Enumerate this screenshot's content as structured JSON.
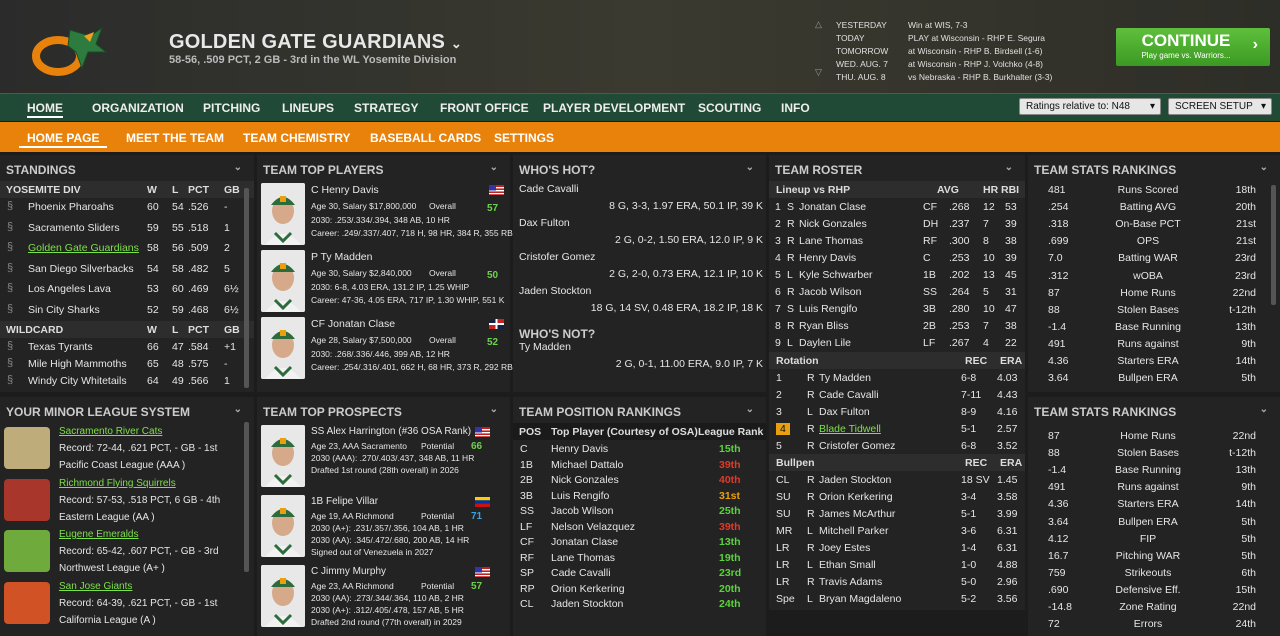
{
  "header": {
    "team_name": "GOLDEN GATE GUARDIANS",
    "record_line": "58-56, .509 PCT, 2 GB - 3rd in the WL Yosemite Division",
    "schedule": [
      {
        "day": "YESTERDAY",
        "text": "Win at WIS, 7-3"
      },
      {
        "day": "TODAY",
        "text": "PLAY at Wisconsin - RHP E. Segura"
      },
      {
        "day": "TOMORROW",
        "text": "at Wisconsin - RHP B. Birdsell (1-6)"
      },
      {
        "day": "WED. AUG. 7",
        "text": "at Wisconsin - RHP J. Volchko (4-8)"
      },
      {
        "day": "THU. AUG. 8",
        "text": "vs Nebraska - RHP B. Burkhalter (3-3)"
      }
    ],
    "continue_label": "CONTINUE",
    "continue_sub": "Play game vs. Warriors..."
  },
  "nav": {
    "main": [
      "HOME",
      "ORGANIZATION",
      "PITCHING",
      "LINEUPS",
      "STRATEGY",
      "FRONT OFFICE",
      "PLAYER DEVELOPMENT",
      "SCOUTING",
      "INFO"
    ],
    "ratings_select": "Ratings relative to: N48",
    "screen_setup": "SCREEN SETUP",
    "sub": [
      "HOME PAGE",
      "MEET THE TEAM",
      "TEAM CHEMISTRY",
      "BASEBALL CARDS",
      "SETTINGS"
    ]
  },
  "standings": {
    "title": "STANDINGS",
    "div_header": [
      "YOSEMITE DIV",
      "W",
      "L",
      "PCT",
      "GB"
    ],
    "div": [
      [
        "Phoenix Pharoahs",
        "60",
        "54",
        ".526",
        "-"
      ],
      [
        "Sacramento Sliders",
        "59",
        "55",
        ".518",
        "1"
      ],
      [
        "Golden Gate Guardians",
        "58",
        "56",
        ".509",
        "2"
      ],
      [
        "San Diego Silverbacks",
        "54",
        "58",
        ".482",
        "5"
      ],
      [
        "Los Angeles Lava",
        "53",
        "60",
        ".469",
        "6½"
      ],
      [
        "Sin City Sharks",
        "52",
        "59",
        ".468",
        "6½"
      ]
    ],
    "wc_header": [
      "WILDCARD",
      "W",
      "L",
      "PCT",
      "GB"
    ],
    "wc": [
      [
        "Texas Tyrants",
        "66",
        "47",
        ".584",
        "+1"
      ],
      [
        "Mile High Mammoths",
        "65",
        "48",
        ".575",
        "-"
      ],
      [
        "Windy City Whitetails",
        "64",
        "49",
        ".566",
        "1"
      ]
    ]
  },
  "top_players": {
    "title": "TEAM TOP PLAYERS",
    "players": [
      {
        "name": "C Henry Davis",
        "l1": "Age 30, Salary $17,800,000",
        "ovr_label": "Overall",
        "ovr": "57",
        "l2": "2030: .253/.334/.394, 348 AB, 10 HR",
        "l3": "Career: .249/.337/.407, 718 H, 98 HR, 384 R, 355 RBI"
      },
      {
        "name": "P Ty Madden",
        "l1": "Age 30, Salary $2,840,000",
        "ovr_label": "Overall",
        "ovr": "50",
        "l2": "2030: 6-8, 4.03 ERA, 131.2 IP, 1.25 WHIP",
        "l3": "Career: 47-36, 4.05 ERA, 717 IP, 1.30 WHIP, 551 K"
      },
      {
        "name": "CF Jonatan Clase",
        "l1": "Age 28, Salary $7,500,000",
        "ovr_label": "Overall",
        "ovr": "52",
        "l2": "2030: .268/.336/.446, 399 AB, 12 HR",
        "l3": "Career: .254/.316/.401, 662 H, 68 HR, 373 R, 292 RBI"
      }
    ]
  },
  "hot": {
    "title": "WHO'S HOT?",
    "items": [
      [
        "Cade Cavalli",
        "8 G, 3-3, 1.97 ERA, 50.1 IP, 39 K"
      ],
      [
        "Dax Fulton",
        "2 G, 0-2, 1.50 ERA, 12.0 IP, 9 K"
      ],
      [
        "Cristofer Gomez",
        "2 G, 2-0, 0.73 ERA, 12.1 IP, 10 K"
      ],
      [
        "Jaden Stockton",
        "18 G, 14 SV, 0.48 ERA, 18.2 IP, 18 K"
      ]
    ],
    "not_title": "WHO'S NOT?",
    "not_items": [
      [
        "Ty Madden",
        "2 G, 0-1, 11.00 ERA, 9.0 IP, 7 K"
      ]
    ]
  },
  "roster": {
    "title": "TEAM ROSTER",
    "lineup_header": [
      "Lineup vs RHP",
      "AVG",
      "HR",
      "RBI"
    ],
    "lineup": [
      [
        "1",
        "S",
        "Jonatan Clase",
        "CF",
        ".268",
        "12",
        "53"
      ],
      [
        "2",
        "R",
        "Nick Gonzales",
        "DH",
        ".237",
        "7",
        "39"
      ],
      [
        "3",
        "R",
        "Lane Thomas",
        "RF",
        ".300",
        "8",
        "38"
      ],
      [
        "4",
        "R",
        "Henry Davis",
        "C",
        ".253",
        "10",
        "39"
      ],
      [
        "5",
        "L",
        "Kyle Schwarber",
        "1B",
        ".202",
        "13",
        "45"
      ],
      [
        "6",
        "R",
        "Jacob Wilson",
        "SS",
        ".264",
        "5",
        "31"
      ],
      [
        "7",
        "S",
        "Luis Rengifo",
        "3B",
        ".280",
        "10",
        "47"
      ],
      [
        "8",
        "R",
        "Ryan Bliss",
        "2B",
        ".253",
        "7",
        "38"
      ],
      [
        "9",
        "L",
        "Daylen Lile",
        "LF",
        ".267",
        "4",
        "22"
      ]
    ],
    "rot_header": [
      "Rotation",
      "REC",
      "ERA"
    ],
    "rotation": [
      [
        "1",
        "R",
        "Ty Madden",
        "6-8",
        "4.03"
      ],
      [
        "2",
        "R",
        "Cade Cavalli",
        "7-11",
        "4.43"
      ],
      [
        "3",
        "L",
        "Dax Fulton",
        "8-9",
        "4.16"
      ],
      [
        "4",
        "R",
        "Blade Tidwell",
        "5-1",
        "2.57"
      ],
      [
        "5",
        "R",
        "Cristofer Gomez",
        "6-8",
        "3.52"
      ]
    ],
    "bp_header": [
      "Bullpen",
      "REC",
      "ERA"
    ],
    "bullpen": [
      [
        "CL",
        "R",
        "Jaden Stockton",
        "18 SV",
        "1.45"
      ],
      [
        "SU",
        "R",
        "Orion Kerkering",
        "3-4",
        "3.58"
      ],
      [
        "SU",
        "R",
        "James McArthur",
        "5-1",
        "3.99"
      ],
      [
        "MR",
        "L",
        "Mitchell Parker",
        "3-6",
        "6.31"
      ],
      [
        "LR",
        "R",
        "Joey Estes",
        "1-4",
        "6.31"
      ],
      [
        "LR",
        "L",
        "Ethan Small",
        "1-0",
        "4.88"
      ],
      [
        "LR",
        "R",
        "Travis Adams",
        "5-0",
        "2.96"
      ],
      [
        "Spe",
        "L",
        "Bryan Magdaleno",
        "5-2",
        "3.56"
      ]
    ]
  },
  "stats1": {
    "title": "TEAM STATS RANKINGS",
    "rows": [
      [
        "481",
        "Runs Scored",
        "18th"
      ],
      [
        ".254",
        "Batting AVG",
        "20th"
      ],
      [
        ".318",
        "On-Base PCT",
        "21st"
      ],
      [
        ".699",
        "OPS",
        "21st"
      ],
      [
        "7.0",
        "Batting WAR",
        "23rd"
      ],
      [
        ".312",
        "wOBA",
        "23rd"
      ],
      [
        "87",
        "Home Runs",
        "22nd"
      ],
      [
        "88",
        "Stolen Bases",
        "t-12th"
      ],
      [
        "-1.4",
        "Base Running",
        "13th"
      ],
      [
        "491",
        "Runs against",
        "9th"
      ],
      [
        "4.36",
        "Starters ERA",
        "14th"
      ],
      [
        "3.64",
        "Bullpen ERA",
        "5th"
      ]
    ]
  },
  "minors": {
    "title": "YOUR MINOR LEAGUE SYSTEM",
    "teams": [
      {
        "name": "Sacramento River Cats",
        "l1": "Record: 72-44, .621 PCT, - GB - 1st",
        "l2": "Pacific Coast League (AAA )"
      },
      {
        "name": "Richmond Flying Squirrels",
        "l1": "Record: 57-53, .518 PCT, 6 GB - 4th",
        "l2": "Eastern League (AA )"
      },
      {
        "name": "Eugene Emeralds",
        "l1": "Record: 65-42, .607 PCT, - GB - 3rd",
        "l2": "Northwest League (A+ )"
      },
      {
        "name": "San Jose Giants",
        "l1": "Record: 64-39, .621 PCT, - GB - 1st",
        "l2": "California League (A )"
      }
    ]
  },
  "prospects": {
    "title": "TEAM TOP PROSPECTS",
    "items": [
      {
        "name": "SS Alex Harrington (#36 OSA Rank)",
        "l1": "Age 23, AAA Sacramento",
        "pot_label": "Potential",
        "pot": "66",
        "l2": "2030 (AAA): .270/.403/.437, 348 AB, 11 HR",
        "l3": "Drafted 1st round (28th overall) in 2026"
      },
      {
        "name": "1B Felipe Villar",
        "l1": "Age 19, AA Richmond",
        "pot_label": "Potential",
        "pot": "71",
        "l2": "2030 (A+): .231/.357/.356, 104 AB, 1 HR",
        "l3": "2030 (AA): .345/.472/.680, 200 AB, 14 HR",
        "l4": "Signed out of Venezuela in 2027"
      },
      {
        "name": "C Jimmy Murphy",
        "l1": "Age 23, AA Richmond",
        "pot_label": "Potential",
        "pot": "57",
        "l2": "2030 (AA): .273/.344/.364, 110 AB, 2 HR",
        "l3": "2030 (A+): .312/.405/.478, 157 AB, 5 HR",
        "l4": "Drafted 2nd round (77th overall) in 2029"
      }
    ]
  },
  "pos_rank": {
    "title": "TEAM POSITION RANKINGS",
    "header": [
      "POS",
      "Top Player (Courtesy of OSA)",
      "League Rank"
    ],
    "rows": [
      [
        "C",
        "Henry Davis",
        "15th",
        "#5cd23c"
      ],
      [
        "1B",
        "Michael Dattalo",
        "39th",
        "#e03a2a"
      ],
      [
        "2B",
        "Nick Gonzales",
        "40th",
        "#e03a2a"
      ],
      [
        "3B",
        "Luis Rengifo",
        "31st",
        "#e8a010"
      ],
      [
        "SS",
        "Jacob Wilson",
        "25th",
        "#5cd23c"
      ],
      [
        "LF",
        "Nelson Velazquez",
        "39th",
        "#e03a2a"
      ],
      [
        "CF",
        "Jonatan Clase",
        "13th",
        "#5cd23c"
      ],
      [
        "RF",
        "Lane Thomas",
        "19th",
        "#5cd23c"
      ],
      [
        "SP",
        "Cade Cavalli",
        "23rd",
        "#5cd23c"
      ],
      [
        "RP",
        "Orion Kerkering",
        "20th",
        "#5cd23c"
      ],
      [
        "CL",
        "Jaden Stockton",
        "24th",
        "#5cd23c"
      ]
    ]
  },
  "stats2": {
    "title": "TEAM STATS RANKINGS",
    "rows": [
      [
        "87",
        "Home Runs",
        "22nd"
      ],
      [
        "88",
        "Stolen Bases",
        "t-12th"
      ],
      [
        "-1.4",
        "Base Running",
        "13th"
      ],
      [
        "491",
        "Runs against",
        "9th"
      ],
      [
        "4.36",
        "Starters ERA",
        "14th"
      ],
      [
        "3.64",
        "Bullpen ERA",
        "5th"
      ],
      [
        "4.12",
        "FIP",
        "5th"
      ],
      [
        "16.7",
        "Pitching WAR",
        "5th"
      ],
      [
        "759",
        "Strikeouts",
        "6th"
      ],
      [
        ".690",
        "Defensive Eff.",
        "15th"
      ],
      [
        "-14.8",
        "Zone Rating",
        "22nd"
      ],
      [
        "72",
        "Errors",
        "24th"
      ]
    ]
  }
}
